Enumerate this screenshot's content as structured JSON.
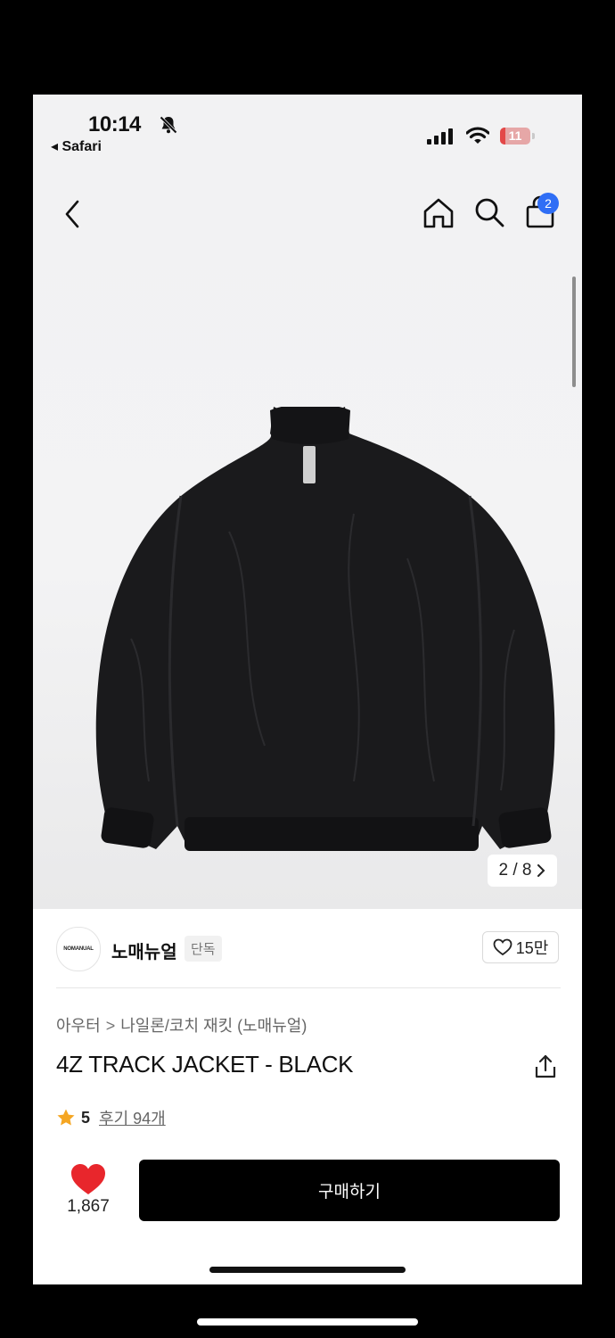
{
  "status_bar": {
    "time": "10:14",
    "back_app": "◂ Safari",
    "battery": "11",
    "icons": [
      "bell-muted-icon",
      "signal-icon",
      "wifi-icon",
      "battery-icon"
    ]
  },
  "nav": {
    "cart_badge": "2",
    "icons": [
      "back-icon",
      "home-icon",
      "search-icon",
      "cart-icon"
    ]
  },
  "gallery": {
    "pager": "2 / 8",
    "image_icon": "jacket-photo"
  },
  "brand": {
    "logo_text": "NOMANUAL",
    "name": "노매뉴얼",
    "tag": "단독",
    "likes": "15만"
  },
  "product": {
    "breadcrumb": [
      "아우터",
      "나일론/코치 재킷 (노매뉴얼)"
    ],
    "breadcrumb_sep": ">",
    "title": "4Z TRACK JACKET - BLACK",
    "rating": "5",
    "reviews": "후기 94개"
  },
  "purchase": {
    "like_count": "1,867",
    "buy_label": "구매하기"
  },
  "colors": {
    "accent_blue": "#2f6ef5",
    "heart_red": "#e8262c",
    "star_orange": "#f5a623",
    "buy_button": "#000000"
  }
}
